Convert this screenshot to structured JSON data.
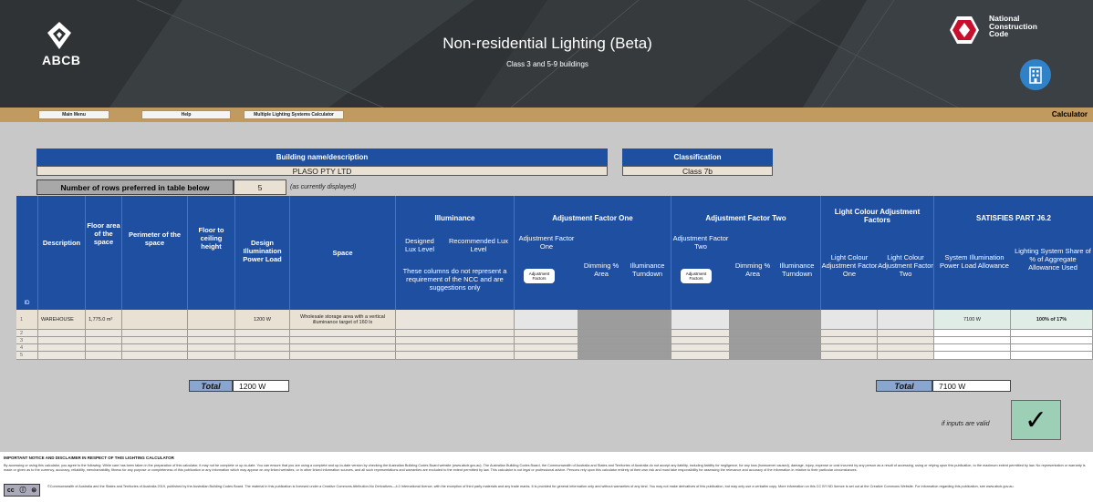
{
  "header": {
    "org": "ABCB",
    "title": "Non-residential Lighting (Beta)",
    "subtitle": "Class 3 and 5-9 buildings",
    "ncc_lines": [
      "National",
      "Construction",
      "Code"
    ]
  },
  "nav": {
    "main_menu": "Main Menu",
    "help": "Help",
    "multiple": "Multiple Lighting Systems Calculator",
    "calculator": "Calculator"
  },
  "building": {
    "name_label": "Building name/description",
    "name_value": "PLASO PTY LTD",
    "class_label": "Classification",
    "class_value": "Class 7b",
    "rows_label": "Number of rows preferred in table below",
    "rows_value": "5",
    "rows_note": "(as currently displayed)"
  },
  "table": {
    "id_label": "ID",
    "headers": {
      "description": "Description",
      "floor_area": "Floor area of the space",
      "perimeter": "Perimeter of the space",
      "ceiling": "Floor to ceiling height",
      "design_load": "Design Illumination Power Load",
      "space": "Space",
      "illuminance": "Illuminance",
      "designed_lux": "Designed Lux Level",
      "recommended_lux": "Recommended Lux Level",
      "illuminance_note": "These columns do not represent a requirement of the NCC and are suggestions only",
      "adj_one": "Adjustment Factor One",
      "adj_one_sub": "Adjustment Factor One",
      "adj_two": "Adjustment Factor Two",
      "adj_two_sub": "Adjustment Factor Two",
      "adj_button": "Adjustment Factors",
      "dimming": "Dimming % Area",
      "turndown": "Illuminance Turndown",
      "lc_title": "Light Colour Adjustment Factors",
      "lc_one": "Light Colour Adjustment Factor One",
      "lc_two": "Light Colour Adjustment Factor Two",
      "satisfies": "SATISFIES PART J6.2",
      "allowance": "System Illumination Power Load Allowance",
      "share": "Lighting System Share of % of Aggregate Allowance Used"
    },
    "rows": [
      {
        "id": "1",
        "description": "WAREHOUSE",
        "floor_area": "1,775.0 m²",
        "design_load": "1200 W",
        "space": "Wholesale storage area with a vertical illuminance target of 160 lx",
        "allowance": "7100 W",
        "share": "100% of 17%"
      },
      {
        "id": "2"
      },
      {
        "id": "3"
      },
      {
        "id": "4"
      },
      {
        "id": "5"
      }
    ],
    "total_label": "Total",
    "total_load": "1200 W",
    "total_allowance": "7100 W"
  },
  "valid_note": "if inputs are valid",
  "check_mark": "✓",
  "footer": {
    "disclaimer_title": "IMPORTANT NOTICE AND DISCLAIMER IN RESPECT OF THIS LIGHTING CALCULATOR",
    "disclaimer_body": "By accessing or using this calculator, you agree to the following: While care has been taken in the preparation of this calculator, it may not be complete or up-to-date. You can ensure that you are using a complete and up-to-date version by checking the Australian Building Codes Board website (www.abcb.gov.au). The Australian Building Codes Board, the Commonwealth of Australia and States and Territories of Australia do not accept any liability, including liability for negligence, for any loss (howsoever caused), damage, injury, expense or cost incurred by any person as a result of accessing, using or relying upon this publication, to the maximum extent permitted by law. No representation or warranty is made or given as to the currency, accuracy, reliability, merchantability, fitness for any purpose or completeness of this publication or any information which may appear on any linked websites, or in other linked information sources, and all such representations and warranties are excluded to the extent permitted by law. This calculator is not legal or professional advice. Persons rely upon this calculator entirely at their own risk and must take responsibility for assessing the relevance and accuracy of the information in relation to their particular circumstances.",
    "cc_label": "cc",
    "copyright": "©Commonwealth of Australia and the States and Territories of Australia 2019, published by the Australian Building Codes Board. The material in this publication is licensed under a Creative Commons Attribution-No Derivatives—4.0 International licence, with the exception of third party materials and any trade marks. It is provided for general information only and without warranties of any kind. You may not make derivatives of this publication, but may only use a verbatim copy. More information on this CC BY ND licence is set out at the Creative Commons Website. For information regarding this publication, see www.abcb.gov.au."
  }
}
